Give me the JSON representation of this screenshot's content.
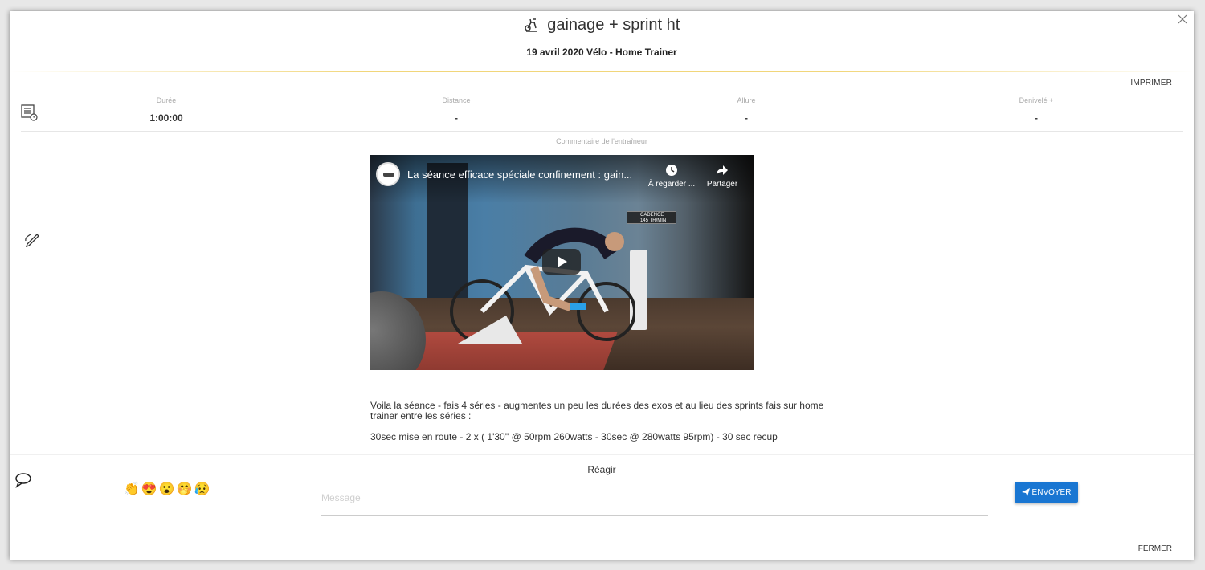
{
  "modal": {
    "title": "gainage + sprint ht",
    "subtitle": "19 avril 2020 Vélo - Home Trainer",
    "print_label": "IMPRIMER",
    "close_label": "FERMER"
  },
  "stats": [
    {
      "label": "Durée",
      "value": "1:00:00"
    },
    {
      "label": "Distance",
      "value": "-"
    },
    {
      "label": "Allure",
      "value": "-"
    },
    {
      "label": "Denivelé +",
      "value": "-"
    }
  ],
  "coach": {
    "label": "Commentaire de l'entraîneur",
    "video": {
      "title": "La séance efficace spéciale confinement : gain...",
      "watch_later": "À regarder ...",
      "share": "Partager",
      "cadence": "CADENCE",
      "cadence_value": "145 TR/MIN"
    },
    "text1": "Voila la séance - fais 4 séries - augmentes un peu les durées des exos et au lieu des sprints fais sur home trainer entre les séries :",
    "text2": "30sec mise en route - 2 x ( 1'30'' @ 50rpm 260watts - 30sec @ 280watts 95rpm) - 30 sec recup"
  },
  "react": {
    "label": "Réagir",
    "emojis": [
      "👏",
      "😍",
      "😮",
      "🤭",
      "😥"
    ],
    "message_placeholder": "Message",
    "send_label": "ENVOYER"
  },
  "colors": {
    "accent": "#1976d2",
    "header_line": "#f1d67a"
  }
}
